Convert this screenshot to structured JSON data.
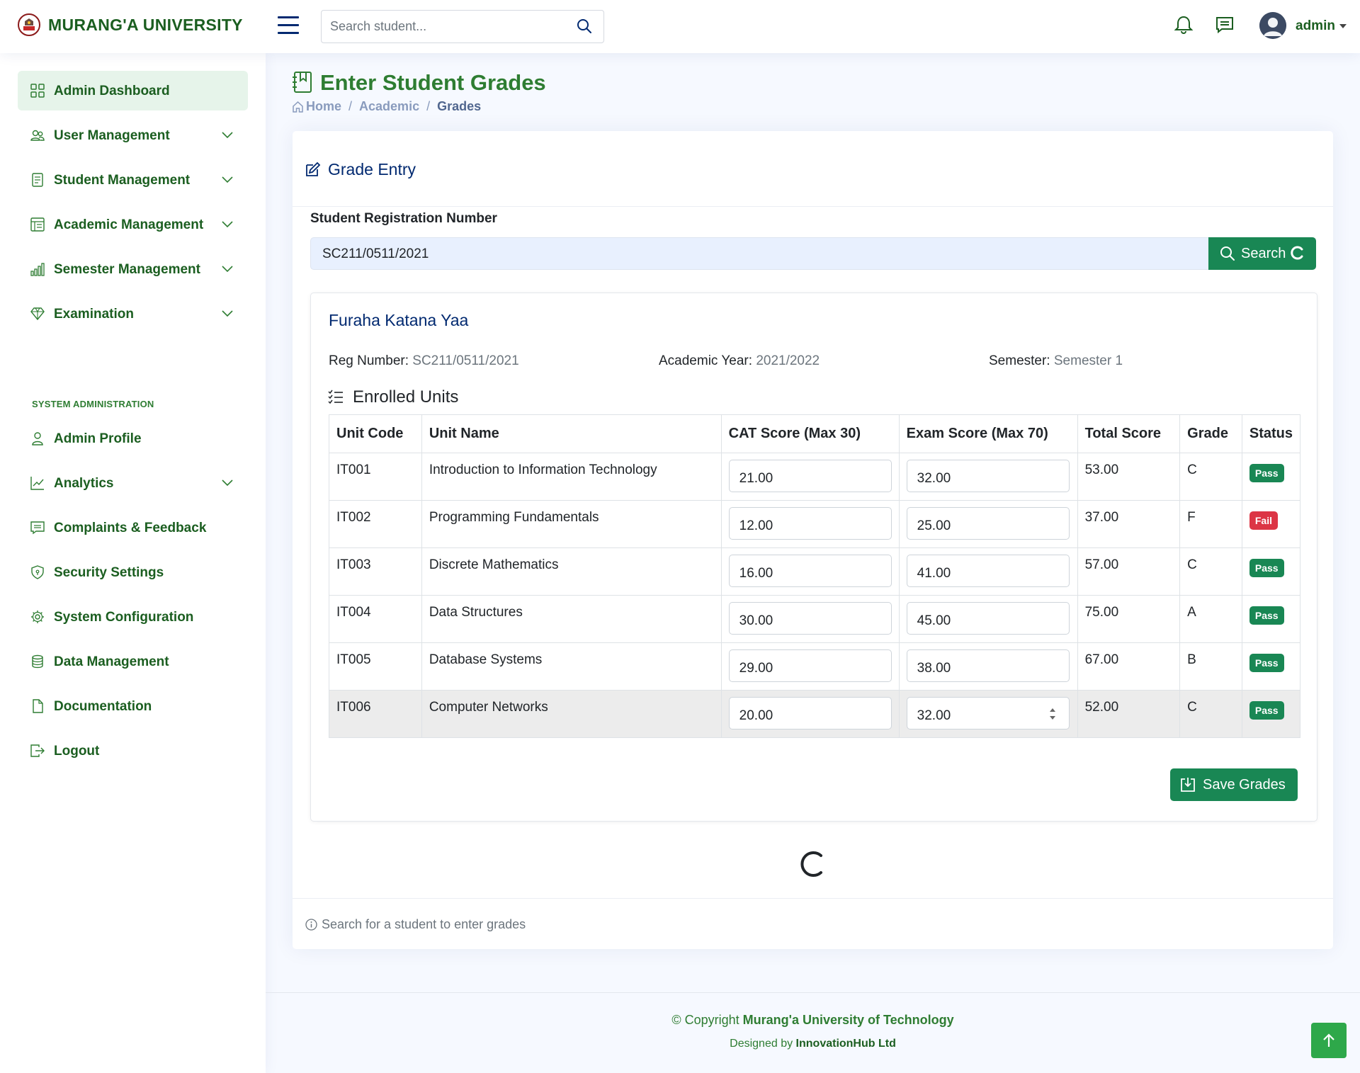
{
  "header": {
    "logo_text": "MURANG'A UNIVERSITY",
    "search_placeholder": "Search student...",
    "user_name": "admin"
  },
  "sidebar": {
    "items": [
      {
        "label": "Admin Dashboard",
        "icon": "grid-icon"
      },
      {
        "label": "User Management",
        "icon": "people-icon"
      },
      {
        "label": "Student Management",
        "icon": "journal-icon"
      },
      {
        "label": "Academic Management",
        "icon": "layout-text-icon"
      },
      {
        "label": "Semester Management",
        "icon": "bar-chart-icon"
      },
      {
        "label": "Examination",
        "icon": "gem-icon"
      },
      {
        "label": "Admin Profile",
        "icon": "person-icon"
      },
      {
        "label": "Analytics",
        "icon": "graph-up-icon"
      },
      {
        "label": "Complaints & Feedback",
        "icon": "chat-square-icon"
      },
      {
        "label": "Security Settings",
        "icon": "shield-icon"
      },
      {
        "label": "System Configuration",
        "icon": "gear-icon"
      },
      {
        "label": "Data Management",
        "icon": "database-icon"
      },
      {
        "label": "Documentation",
        "icon": "file-icon"
      },
      {
        "label": "Logout",
        "icon": "box-arrow-right-icon"
      }
    ],
    "section_heading": "SYSTEM ADMINISTRATION"
  },
  "page": {
    "title": "Enter Student Grades",
    "breadcrumb": [
      "Home",
      "Academic",
      "Grades"
    ]
  },
  "grade_entry": {
    "card_title": "Grade Entry",
    "reg_label": "Student Registration Number",
    "reg_value": "SC211/0511/2021",
    "search_button": "Search",
    "student_name": "Furaha Katana Yaa",
    "reg_number_label": "Reg Number:",
    "reg_number_value": "SC211/0511/2021",
    "academic_year_label": "Academic Year:",
    "academic_year_value": "2021/2022",
    "semester_label": "Semester:",
    "semester_value": "Semester 1",
    "enrolled_title": "Enrolled Units",
    "columns": [
      "Unit Code",
      "Unit Name",
      "CAT Score (Max 30)",
      "Exam Score (Max 70)",
      "Total Score",
      "Grade",
      "Status"
    ],
    "rows": [
      {
        "code": "IT001",
        "name": "Introduction to Information Technology",
        "cat": "21.00",
        "exam": "32.00",
        "total": "53.00",
        "grade": "C",
        "status": "Pass"
      },
      {
        "code": "IT002",
        "name": "Programming Fundamentals",
        "cat": "12.00",
        "exam": "25.00",
        "total": "37.00",
        "grade": "F",
        "status": "Fail"
      },
      {
        "code": "IT003",
        "name": "Discrete Mathematics",
        "cat": "16.00",
        "exam": "41.00",
        "total": "57.00",
        "grade": "C",
        "status": "Pass"
      },
      {
        "code": "IT004",
        "name": "Data Structures",
        "cat": "30.00",
        "exam": "45.00",
        "total": "75.00",
        "grade": "A",
        "status": "Pass"
      },
      {
        "code": "IT005",
        "name": "Database Systems",
        "cat": "29.00",
        "exam": "38.00",
        "total": "67.00",
        "grade": "B",
        "status": "Pass"
      },
      {
        "code": "IT006",
        "name": "Computer Networks",
        "cat": "20.00",
        "exam": "32.00",
        "total": "52.00",
        "grade": "C",
        "status": "Pass"
      }
    ],
    "save_button": "Save Grades",
    "footnote": "Search for a student to enter grades"
  },
  "footer": {
    "copyright_prefix": "© Copyright",
    "copyright_org": "Murang'a University of Technology",
    "designed_prefix": "Designed by",
    "designed_org": "InnovationHub Ltd"
  },
  "colors": {
    "brand_green": "#198754",
    "title_green": "#2e7d32",
    "navy": "#012970",
    "fail_red": "#dc3545"
  }
}
